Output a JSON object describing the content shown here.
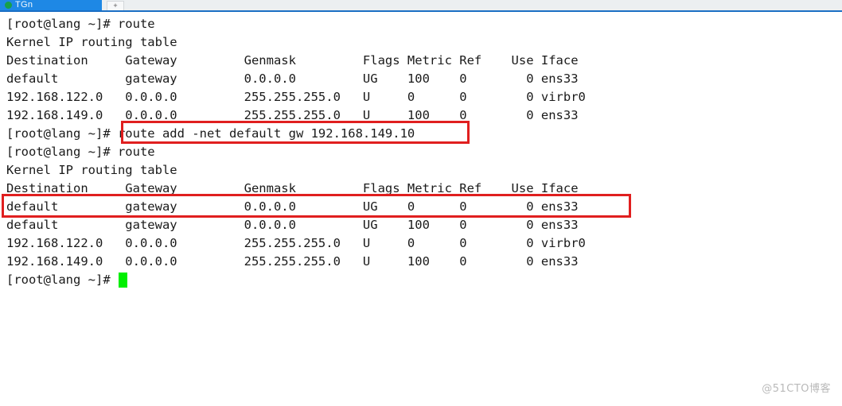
{
  "window": {
    "tab": {
      "title": "TGn",
      "favicon": "globe-icon",
      "new_tab_label": "+"
    }
  },
  "terminal": {
    "prompt": "[root@lang ~]# ",
    "colors": {
      "background": "#ffffff",
      "foreground": "#1a1a1a",
      "cursor": "#00ef00",
      "annotation": "#e01f1f",
      "tab_active": "#1e88e5"
    },
    "lines": [
      {
        "id": "cmd-route-1",
        "text": "[root@lang ~]# route"
      },
      {
        "id": "kernel-header-1",
        "text": "Kernel IP routing table"
      },
      {
        "id": "table1-header",
        "text": "Destination     Gateway         Genmask         Flags Metric Ref    Use Iface"
      },
      {
        "id": "table1-row-1",
        "text": "default         gateway         0.0.0.0         UG    100    0        0 ens33"
      },
      {
        "id": "table1-row-2",
        "text": "192.168.122.0   0.0.0.0         255.255.255.0   U     0      0        0 virbr0"
      },
      {
        "id": "table1-row-3",
        "text": "192.168.149.0   0.0.0.0         255.255.255.0   U     100    0        0 ens33"
      },
      {
        "id": "cmd-route-add",
        "text": "[root@lang ~]# route add -net default gw 192.168.149.10"
      },
      {
        "id": "cmd-route-2",
        "text": "[root@lang ~]# route"
      },
      {
        "id": "kernel-header-2",
        "text": "Kernel IP routing table"
      },
      {
        "id": "table2-header",
        "text": "Destination     Gateway         Genmask         Flags Metric Ref    Use Iface"
      },
      {
        "id": "table2-row-1",
        "text": "default         gateway         0.0.0.0         UG    0      0        0 ens33"
      },
      {
        "id": "table2-row-2",
        "text": "default         gateway         0.0.0.0         UG    100    0        0 ens33"
      },
      {
        "id": "table2-row-3",
        "text": "192.168.122.0   0.0.0.0         255.255.255.0   U     0      0        0 virbr0"
      },
      {
        "id": "table2-row-4",
        "text": "192.168.149.0   0.0.0.0         255.255.255.0   U     100    0        0 ens33"
      },
      {
        "id": "prompt-final",
        "text": "[root@lang ~]# "
      }
    ],
    "routing_tables": [
      {
        "caption": "Kernel IP routing table",
        "columns": [
          "Destination",
          "Gateway",
          "Genmask",
          "Flags",
          "Metric",
          "Ref",
          "Use",
          "Iface"
        ],
        "rows": [
          [
            "default",
            "gateway",
            "0.0.0.0",
            "UG",
            "100",
            "0",
            "0",
            "ens33"
          ],
          [
            "192.168.122.0",
            "0.0.0.0",
            "255.255.255.0",
            "U",
            "0",
            "0",
            "0",
            "virbr0"
          ],
          [
            "192.168.149.0",
            "0.0.0.0",
            "255.255.255.0",
            "U",
            "100",
            "0",
            "0",
            "ens33"
          ]
        ]
      },
      {
        "caption": "Kernel IP routing table",
        "columns": [
          "Destination",
          "Gateway",
          "Genmask",
          "Flags",
          "Metric",
          "Ref",
          "Use",
          "Iface"
        ],
        "rows": [
          [
            "default",
            "gateway",
            "0.0.0.0",
            "UG",
            "0",
            "0",
            "0",
            "ens33"
          ],
          [
            "default",
            "gateway",
            "0.0.0.0",
            "UG",
            "100",
            "0",
            "0",
            "ens33"
          ],
          [
            "192.168.122.0",
            "0.0.0.0",
            "255.255.255.0",
            "U",
            "0",
            "0",
            "0",
            "virbr0"
          ],
          [
            "192.168.149.0",
            "0.0.0.0",
            "255.255.255.0",
            "U",
            "100",
            "0",
            "0",
            "ens33"
          ]
        ]
      }
    ],
    "commands": [
      "route",
      "route add -net default gw 192.168.149.10",
      "route"
    ]
  },
  "annotations": [
    {
      "id": "highlight-command",
      "label": "route add -net default gw 192.168.149.10"
    },
    {
      "id": "highlight-new-route",
      "label": "default         gateway         0.0.0.0         UG    0      0        0 ens33"
    }
  ],
  "watermark": {
    "text": "@51CTO博客"
  }
}
